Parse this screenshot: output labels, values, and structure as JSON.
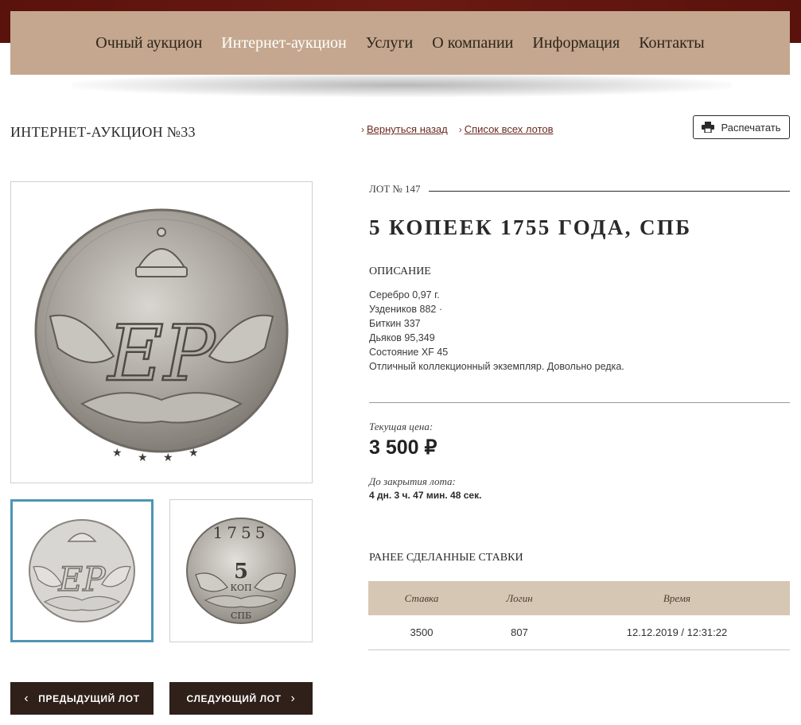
{
  "nav": {
    "items": [
      {
        "label": "Очный аукцион"
      },
      {
        "label": "Интернет-аукцион"
      },
      {
        "label": "Услуги"
      },
      {
        "label": "О компании"
      },
      {
        "label": "Информация"
      },
      {
        "label": "Контакты"
      }
    ],
    "active_index": 1
  },
  "header": {
    "auction_title": "ИНТЕРНЕТ-АУКЦИОН №33",
    "breadcrumbs": [
      {
        "label": "Вернуться назад"
      },
      {
        "label": "Список всех лотов"
      }
    ],
    "print_label": "Распечатать"
  },
  "lot": {
    "number_label": "ЛОТ № 147",
    "name": "5 КОПЕЕК 1755 ГОДА, СПБ",
    "description_heading": "ОПИСАНИЕ",
    "description_lines": [
      "Серебро 0,97 г.",
      "Уздеников 882 ·",
      "Биткин 337",
      "Дьяков 95,349",
      "Состояние XF 45",
      "Отличный коллекционный экземпляр. Довольно редка."
    ],
    "current_price_label": "Текущая цена:",
    "current_price": "3 500 ₽",
    "closing_label": "До закрытия лота:",
    "closing_value": "4 дн. 3 ч. 47 мин. 48 сек."
  },
  "bids": {
    "heading": "РАНЕЕ СДЕЛАННЫЕ СТАВКИ",
    "columns": [
      "Ставка",
      "Логин",
      "Время"
    ],
    "rows": [
      [
        "3500",
        "807",
        "12.12.2019 / 12:31:22"
      ]
    ]
  },
  "navigation": {
    "prev_label": "ПРЕДЫДУЩИЙ ЛОТ",
    "next_label": "СЛЕДУЮЩИЙ ЛОТ"
  },
  "images": {
    "obverse_monogram": "ЕР",
    "reverse_denomination": "5",
    "reverse_unit": "КОП",
    "reverse_year": "1755",
    "reverse_mint": "СПБ"
  },
  "colors": {
    "top_band": "#5a120c",
    "nav_bg": "#c4a78e",
    "nav_active": "#ffffff",
    "link": "#6b2a20",
    "button_dark": "#2f2019",
    "table_header": "#d6c7b5",
    "thumb_selected": "#4f94b3"
  }
}
